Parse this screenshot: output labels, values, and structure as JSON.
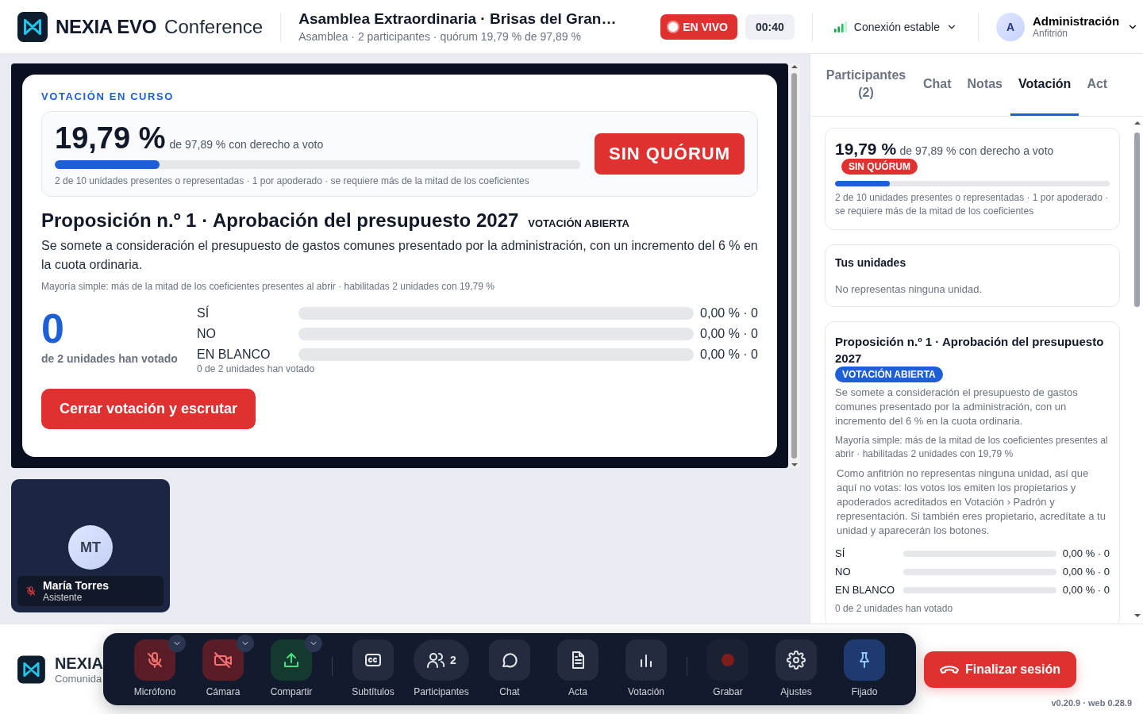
{
  "header": {
    "brand": "NEXIA EVO",
    "product": "Conference",
    "title": "Asamblea Extraordinaria · Brisas del Gran…",
    "subtitle": "Asamblea · 2 participantes · quórum 19,79 % de 97,89 %",
    "live": "EN VIVO",
    "timer": "00:40",
    "connection": "Conexión estable",
    "user": {
      "initial": "A",
      "name": "Administración",
      "role": "Anfitrión"
    }
  },
  "stage": {
    "section": "VOTACIÓN EN CURSO",
    "quorum": {
      "value": "19,79 %",
      "of": "de 97,89 % con derecho a voto",
      "level": 0.2,
      "note": "2 de 10 unidades presentes o representadas · 1 por apoderado · se requiere más de la mitad de los coeficientes",
      "status": "SIN QUÓRUM",
      "met": false
    },
    "proposal": {
      "title": "Proposición n.º 1 · Aprobación del presupuesto 2027",
      "state": "VOTACIÓN ABIERTA",
      "description": "Se somete a consideración el presupuesto de gastos comunes presentado por la administración, con un incremento del 6 % en la cuota ordinaria.",
      "rule": "Mayoría simple: más de la mitad de los coeficientes presentes al abrir · habilitadas 2 unidades con 19,79 %",
      "count": "0",
      "count_label": "de 2 unidades han votado",
      "options": [
        {
          "label": "SÍ",
          "level": 0,
          "reading": "0,00 % · 0"
        },
        {
          "label": "NO",
          "level": 0,
          "reading": "0,00 % · 0"
        },
        {
          "label": "EN BLANCO",
          "level": 0,
          "reading": "0,00 % · 0"
        }
      ],
      "votes_note": "0 de 2 unidades han votado",
      "close_button": "Cerrar votación y escrutar"
    }
  },
  "participants": [
    {
      "initials": "MT",
      "name": "María Torres",
      "role": "Asistente",
      "muted": true
    }
  ],
  "panel": {
    "tabs": [
      {
        "label": "Participantes (2)",
        "selected": false
      },
      {
        "label": "Chat",
        "selected": false
      },
      {
        "label": "Notas",
        "selected": false
      },
      {
        "label": "Votación",
        "selected": true
      },
      {
        "label": "Act",
        "selected": false
      }
    ],
    "quorum": {
      "value": "19,79 %",
      "of": "de 97,89 % con derecho a voto",
      "status": "SIN QUÓRUM",
      "met": false,
      "level": 0.2,
      "note": "2 de 10 unidades presentes o representadas · 1 por apoderado · se requiere más de la mitad de los coeficientes"
    },
    "units": {
      "title": "Tus unidades",
      "text": "No representas ninguna unidad."
    },
    "proposal": {
      "title": "Proposición n.º 1 · Aprobación del presupuesto 2027",
      "state": "VOTACIÓN ABIERTA",
      "description": "Se somete a consideración el presupuesto de gastos comunes presentado por la administración, con un incremento del 6 % en la cuota ordinaria.",
      "rule": "Mayoría simple: más de la mitad de los coeficientes presentes al abrir · habilitadas 2 unidades con 19,79 %",
      "host_note": "Como anfitrión no representas ninguna unidad, así que aquí no votas: los votos los emiten los propietarios y apoderados acreditados en Votación › Padrón y representación. Si también eres propietario, acredítate a tu unidad y aparecerán los botones.",
      "options": [
        {
          "label": "SÍ",
          "level": 0,
          "reading": "0,00 % · 0"
        },
        {
          "label": "NO",
          "level": 0,
          "reading": "0,00 % · 0"
        },
        {
          "label": "EN BLANCO",
          "level": 0,
          "reading": "0,00 % · 0"
        }
      ],
      "votes_note": "0 de 2 unidades han votado"
    }
  },
  "footer": {
    "brand": "NEXIA",
    "sub": "Comunida",
    "end_button": "Finalizar sesión",
    "version": "v0.20.9 · web 0.28.9"
  },
  "toolbar": [
    [
      {
        "kind": "mic",
        "label": "Micrófono",
        "on": false,
        "menu": true
      },
      {
        "kind": "camera",
        "label": "Cámara",
        "on": false,
        "menu": true
      },
      {
        "kind": "share",
        "label": "Compartir",
        "menu": true
      }
    ],
    [
      {
        "kind": "captions",
        "label": "Subtítulos"
      },
      {
        "kind": "people",
        "label": "Participantes",
        "count": "2"
      },
      {
        "kind": "chat",
        "label": "Chat"
      },
      {
        "kind": "document",
        "label": "Acta"
      },
      {
        "kind": "poll",
        "label": "Votación"
      }
    ],
    [
      {
        "kind": "record",
        "label": "Grabar",
        "on": false
      },
      {
        "kind": "settings",
        "label": "Ajustes"
      },
      {
        "kind": "pin",
        "label": "Fijado",
        "on": true
      }
    ]
  ]
}
